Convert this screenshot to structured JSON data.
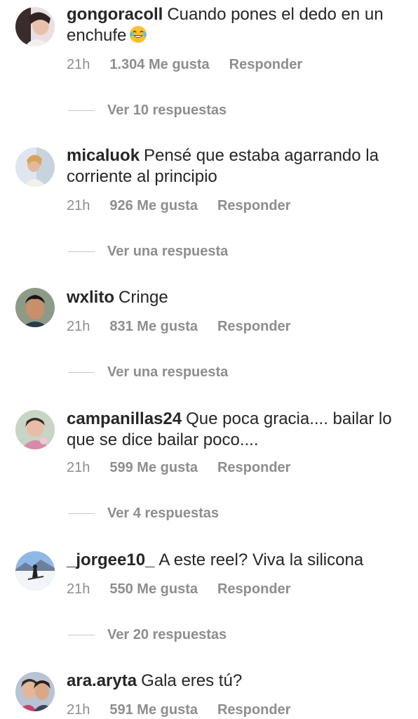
{
  "comments": [
    {
      "username": "gongoracoll",
      "text": "Cuando pones el dedo en un enchufe",
      "emoji_icon": "face-with-tears-of-joy-icon",
      "time": "21h",
      "likes": "1.304 Me gusta",
      "reply": "Responder",
      "view_replies": "Ver 10 respuestas"
    },
    {
      "username": "micaluok",
      "text": "Pensé que estaba agarrando la corriente al principio",
      "time": "21h",
      "likes": "926 Me gusta",
      "reply": "Responder",
      "view_replies": "Ver una respuesta"
    },
    {
      "username": "wxlito",
      "text": "Cringe",
      "time": "21h",
      "likes": "831 Me gusta",
      "reply": "Responder",
      "view_replies": "Ver una respuesta"
    },
    {
      "username": "campanillas24",
      "text": "Que poca gracia.... bailar lo que se dice bailar poco....",
      "time": "21h",
      "likes": "599 Me gusta",
      "reply": "Responder",
      "view_replies": "Ver 4 respuestas"
    },
    {
      "username": "_jorgee10_",
      "text": "A este reel? Viva la silicona",
      "time": "21h",
      "likes": "550 Me gusta",
      "reply": "Responder",
      "view_replies": "Ver 20 respuestas"
    },
    {
      "username": "ara.aryta",
      "text": "Gala eres tú?",
      "time": "21h",
      "likes": "591 Me gusta",
      "reply": "Responder"
    }
  ],
  "colors": {
    "text": "#262626",
    "secondary": "#8e8e8e",
    "divider": "#c7c7c7",
    "background": "#ffffff"
  }
}
